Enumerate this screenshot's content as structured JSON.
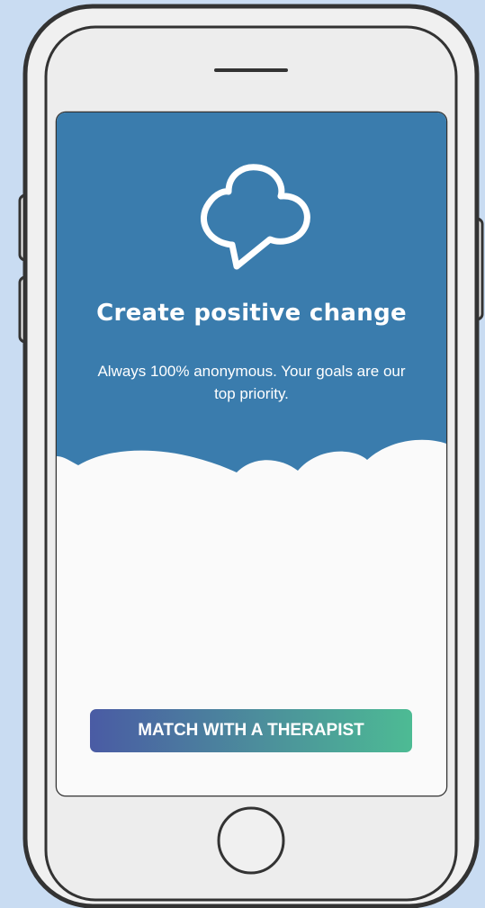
{
  "hero": {
    "logo_icon": "speech-cloud-icon",
    "headline": "Create positive change",
    "subtitle": "Always 100% anonymous. Your goals are our top priority."
  },
  "cta": {
    "label": "MATCH WITH A THERAPIST"
  },
  "colors": {
    "page_background": "#c9dcf2",
    "hero_blue": "#3a7cad",
    "screen_white": "#fafafa",
    "cta_gradient_start": "#4a5ba4",
    "cta_gradient_end": "#4dbb94",
    "frame_stroke": "#333333"
  }
}
